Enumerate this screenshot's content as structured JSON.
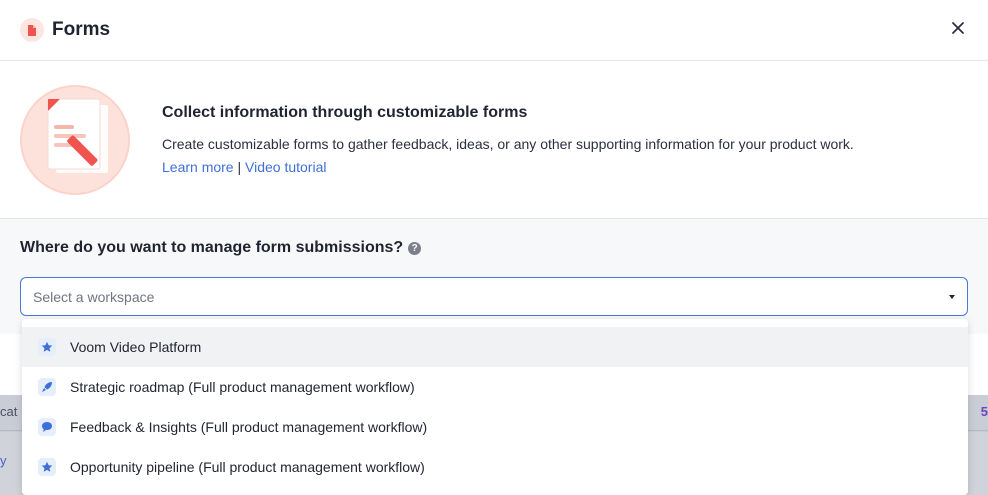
{
  "header": {
    "title": "Forms",
    "icon": "document-icon"
  },
  "intro": {
    "title": "Collect information through customizable forms",
    "description": "Create customizable forms to gather feedback, ideas, or any other supporting information for your product work.",
    "learn_more": "Learn more",
    "separator": "|",
    "video_tutorial": "Video tutorial"
  },
  "manage": {
    "label": "Where do you want to manage form submissions?",
    "help": "?",
    "select_placeholder": "Select a workspace"
  },
  "dropdown": {
    "items": [
      {
        "label": "Voom Video Platform",
        "icon": "star-icon"
      },
      {
        "label": "Strategic roadmap (Full product management workflow)",
        "icon": "rocket-icon"
      },
      {
        "label": "Feedback & Insights (Full product management workflow)",
        "icon": "speech-bubble-icon"
      },
      {
        "label": "Opportunity pipeline (Full product management workflow)",
        "icon": "star-icon"
      }
    ]
  },
  "background": {
    "left_text": "cat",
    "left_text_2": "y",
    "right_text": "5"
  },
  "colors": {
    "accent": "#3f6fd8",
    "brand": "#f0544f",
    "border_focus": "#4a78d9"
  }
}
